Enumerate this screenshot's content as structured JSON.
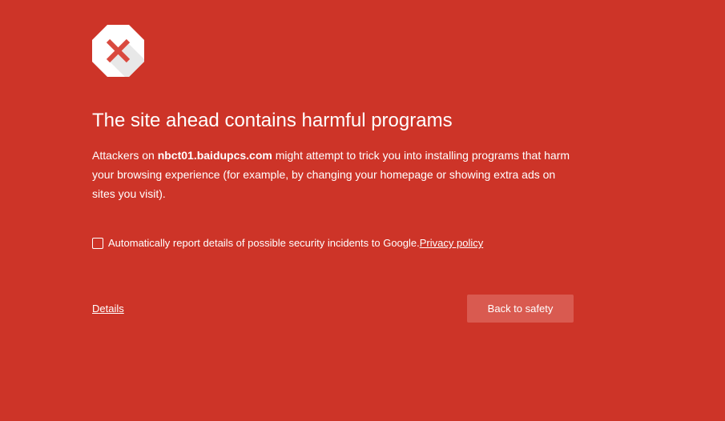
{
  "colors": {
    "background": "#cd3428",
    "button_background": "#d95a50",
    "icon_background": "#ffffff",
    "icon_shadow": "#e8e8e8",
    "icon_cross": "#d94a3f"
  },
  "icon": {
    "name": "error-octagon-icon"
  },
  "interstitial": {
    "title": "The site ahead contains harmful programs",
    "body": {
      "prefix": "Attackers on ",
      "site": "nbct01.baidupcs.com",
      "suffix": " might attempt to trick you into installing programs that harm your browsing experience (for example, by changing your homepage or showing extra ads on sites you visit)."
    },
    "report": {
      "checked": false,
      "label": "Automatically report details of possible security incidents to Google. ",
      "privacy_link": "Privacy policy"
    },
    "details_link": "Details",
    "back_button": "Back to safety"
  }
}
